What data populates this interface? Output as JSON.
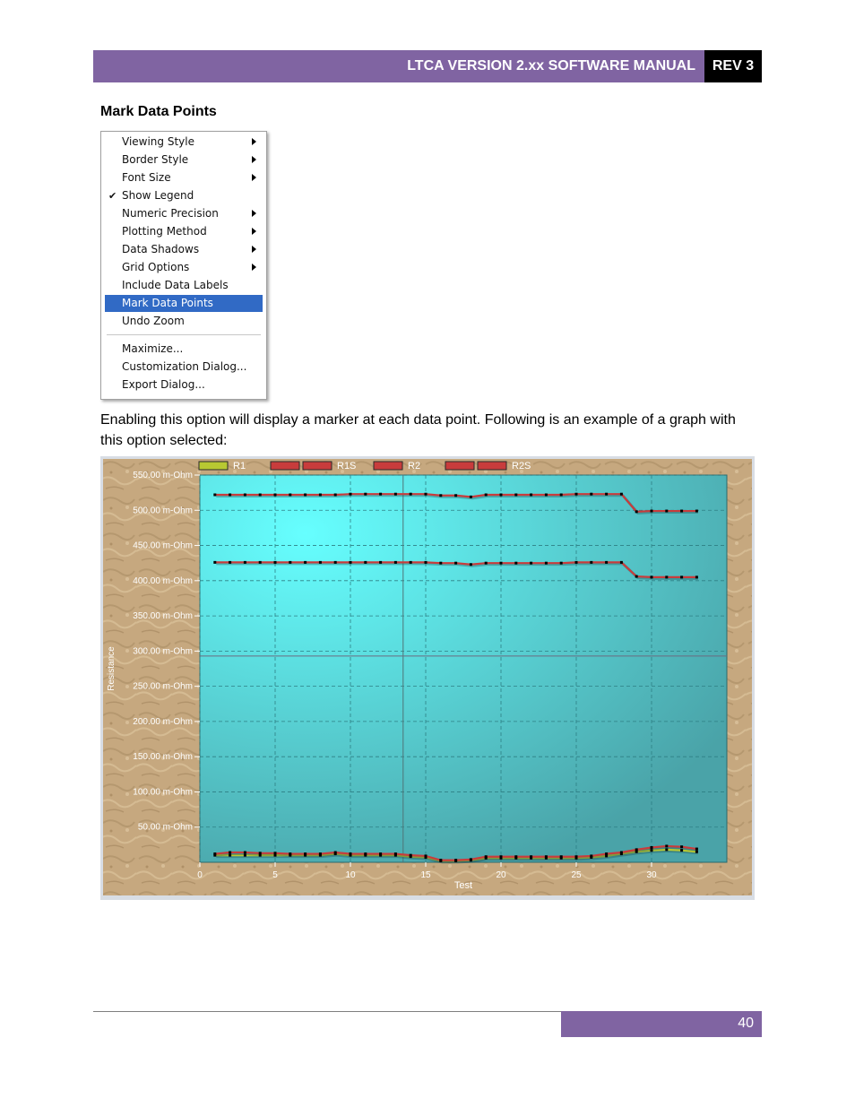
{
  "header": {
    "title": "LTCA VERSION 2.xx SOFTWARE MANUAL",
    "rev": "REV 3"
  },
  "section_title": "Mark Data Points",
  "menu": {
    "items": [
      {
        "label": "Viewing Style",
        "submenu": true,
        "checked": false,
        "selected": false
      },
      {
        "label": "Border Style",
        "submenu": true,
        "checked": false,
        "selected": false
      },
      {
        "label": "Font Size",
        "submenu": true,
        "checked": false,
        "selected": false
      },
      {
        "label": "Show Legend",
        "submenu": false,
        "checked": true,
        "selected": false
      },
      {
        "label": "Numeric Precision",
        "submenu": true,
        "checked": false,
        "selected": false
      },
      {
        "label": "Plotting Method",
        "submenu": true,
        "checked": false,
        "selected": false
      },
      {
        "label": "Data Shadows",
        "submenu": true,
        "checked": false,
        "selected": false
      },
      {
        "label": "Grid Options",
        "submenu": true,
        "checked": false,
        "selected": false
      },
      {
        "label": "Include Data Labels",
        "submenu": false,
        "checked": false,
        "selected": false
      },
      {
        "label": "Mark Data Points",
        "submenu": false,
        "checked": false,
        "selected": true
      },
      {
        "label": "Undo Zoom",
        "submenu": false,
        "checked": false,
        "selected": false
      },
      {
        "label": "Maximize...",
        "submenu": false,
        "checked": false,
        "selected": false
      },
      {
        "label": "Customization Dialog...",
        "submenu": false,
        "checked": false,
        "selected": false
      },
      {
        "label": "Export Dialog...",
        "submenu": false,
        "checked": false,
        "selected": false
      }
    ],
    "check_glyph": "✔"
  },
  "paragraph": "Enabling this option will display a marker at each data point. Following is an example of a graph with this option selected:",
  "chart_data": {
    "type": "line",
    "xlabel": "Test",
    "ylabel": "Resistance",
    "xlim": [
      0,
      35
    ],
    "ylim": [
      0,
      550
    ],
    "xticks": [
      0,
      5,
      10,
      15,
      20,
      25,
      30
    ],
    "yticks": [
      {
        "v": 50,
        "label": "50.00 m-Ohm"
      },
      {
        "v": 100,
        "label": "100.00 m-Ohm"
      },
      {
        "v": 150,
        "label": "150.00 m-Ohm"
      },
      {
        "v": 200,
        "label": "200.00 m-Ohm"
      },
      {
        "v": 250,
        "label": "250.00 m-Ohm"
      },
      {
        "v": 300,
        "label": "300.00 m-Ohm"
      },
      {
        "v": 350,
        "label": "350.00 m-Ohm"
      },
      {
        "v": 400,
        "label": "400.00 m-Ohm"
      },
      {
        "v": 450,
        "label": "450.00 m-Ohm"
      },
      {
        "v": 500,
        "label": "500.00 m-Ohm"
      },
      {
        "v": 550,
        "label": "550.00 m-Ohm"
      }
    ],
    "grid": true,
    "legend_position": "top",
    "x": [
      1,
      2,
      3,
      4,
      5,
      6,
      7,
      8,
      9,
      10,
      11,
      12,
      13,
      14,
      15,
      16,
      17,
      18,
      19,
      20,
      21,
      22,
      23,
      24,
      25,
      26,
      27,
      28,
      29,
      30,
      31,
      32,
      33
    ],
    "series": [
      {
        "name": "R1",
        "color": "#b8c832",
        "values": [
          10,
          10,
          10,
          10,
          10,
          10,
          10,
          10,
          12,
          10,
          10,
          10,
          10,
          8,
          7,
          2,
          2,
          3,
          6,
          6,
          6,
          6,
          6,
          6,
          6,
          7,
          9,
          12,
          15,
          17,
          18,
          17,
          15
        ]
      },
      {
        "name": "R1S",
        "color": "#c83c3c",
        "values": [
          12,
          14,
          14,
          13,
          13,
          12,
          12,
          12,
          14,
          12,
          12,
          12,
          12,
          10,
          9,
          3,
          3,
          4,
          8,
          8,
          8,
          8,
          8,
          8,
          8,
          9,
          12,
          14,
          18,
          21,
          23,
          22,
          19
        ]
      },
      {
        "name": "R2",
        "color": "#c83c3c",
        "values": [
          426,
          426,
          426,
          426,
          426,
          426,
          426,
          426,
          426,
          426,
          426,
          426,
          426,
          426,
          426,
          425,
          425,
          423,
          425,
          425,
          425,
          425,
          425,
          425,
          426,
          426,
          426,
          426,
          406,
          405,
          405,
          405,
          405
        ]
      },
      {
        "name": "R2S",
        "color": "#c83c3c",
        "values": [
          522,
          522,
          522,
          522,
          522,
          522,
          522,
          522,
          522,
          523,
          523,
          523,
          523,
          523,
          523,
          521,
          521,
          519,
          522,
          522,
          522,
          522,
          522,
          522,
          523,
          523,
          523,
          523,
          498,
          499,
          499,
          499,
          499
        ]
      }
    ],
    "background_gradient": [
      "#66ffff",
      "#4aa3a8"
    ],
    "frame_color": "#c3a47b",
    "marker_color": "#000000"
  },
  "footer": {
    "page_number": "40"
  }
}
